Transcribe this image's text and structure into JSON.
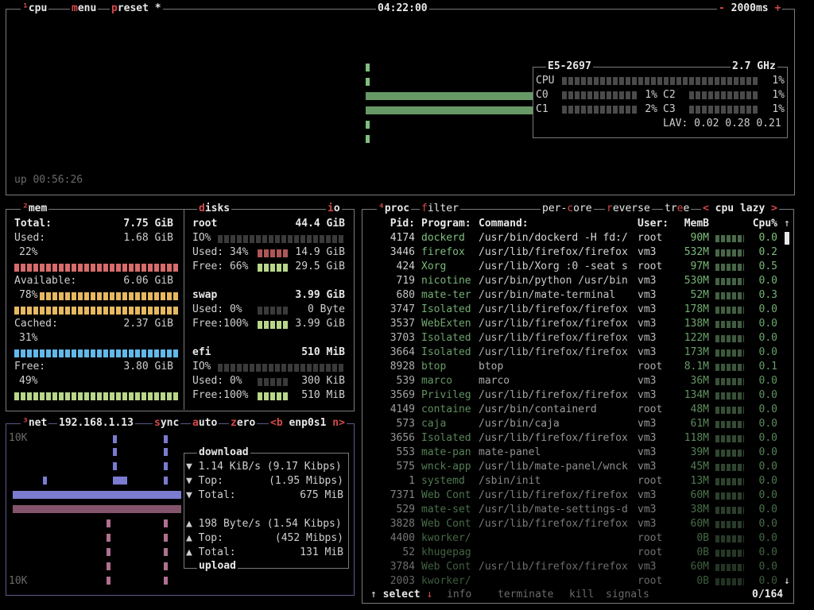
{
  "cpu": {
    "hotkey": "¹",
    "title": "cpu",
    "menu": "menu",
    "preset": "preset *",
    "clock": "04:22:00",
    "refresh": "2000ms",
    "refresh_minus": "-",
    "refresh_plus": "+",
    "uptime": "up 00:56:26",
    "model": "E5-2697",
    "freq": "2.7 GHz",
    "rows": [
      {
        "label": "CPU",
        "pct": "1%"
      },
      {
        "label": "C0",
        "pct": "1%"
      },
      {
        "label": "C1",
        "pct": "2%"
      },
      {
        "label": "C2",
        "pct": "1%"
      },
      {
        "label": "C3",
        "pct": "1%"
      }
    ],
    "lav_label": "LAV:",
    "lav": "0.02 0.28 0.21"
  },
  "mem": {
    "hotkey": "²",
    "title": "mem",
    "total_label": "Total:",
    "total": "7.75 GiB",
    "used_label": "Used:",
    "used": "1.68 GiB",
    "used_pct": "22%",
    "avail_label": "Available:",
    "avail": "6.06 GiB",
    "avail_pct": "78%",
    "cached_label": "Cached:",
    "cached": "2.37 GiB",
    "cached_pct": "31%",
    "free_label": "Free:",
    "free": "3.80 GiB",
    "free_pct": "49%"
  },
  "disks": {
    "title": "disks",
    "io": "io",
    "root": {
      "name": "root",
      "size": "44.4 GiB",
      "io": "IO%",
      "used_label": "Used: 34%",
      "used": "14.9 GiB",
      "free_label": "Free: 66%",
      "free": "29.5 GiB"
    },
    "swap": {
      "name": "swap",
      "size": "3.99 GiB",
      "used_label": "Used:  0%",
      "used": "0 Byte",
      "free_label": "Free:100%",
      "free": "3.99 GiB"
    },
    "efi": {
      "name": "efi",
      "size": "510 MiB",
      "io": "IO%",
      "used_label": "Used:  0%",
      "used": "300 KiB",
      "free_label": "Free:100%",
      "free": "510 MiB"
    }
  },
  "net": {
    "hotkey": "³",
    "title": "net",
    "ip": "192.168.1.13",
    "sync": "sync",
    "auto": "auto",
    "zero": "zero",
    "iface_prev": "<b",
    "iface": "enp0s1",
    "iface_next": "n>",
    "scale_top": "10K",
    "scale_bottom": "10K",
    "download_title": "download",
    "upload_title": "upload",
    "down_rate": "1.14 KiB/s",
    "down_rate_bits": "(9.17 Kibps)",
    "down_top_label": "Top:",
    "down_top": "(1.95 Mibps)",
    "down_total_label": "Total:",
    "down_total": "675 MiB",
    "up_rate": "198 Byte/s",
    "up_rate_bits": "(1.54 Kibps)",
    "up_top_label": "Top:",
    "up_top": "(452 Mibps)",
    "up_total_label": "Total:",
    "up_total": "131 MiB",
    "down_arrow": "▼",
    "up_arrow": "▲"
  },
  "proc": {
    "hotkey": "⁴",
    "title": "proc",
    "filter": "filter",
    "percore": "per-core",
    "reverse": "reverse",
    "tree": "tree",
    "sort_prev": "<",
    "sort": "cpu lazy",
    "sort_next": ">",
    "headers": {
      "pid": "Pid:",
      "program": "Program:",
      "command": "Command:",
      "user": "User:",
      "mem": "MemB",
      "cpu": "Cpu%"
    },
    "rows": [
      {
        "pid": "4174",
        "program": "dockerd",
        "command": "/usr/bin/dockerd -H fd:/",
        "user": "root",
        "mem": "90M",
        "cpu": "0.0"
      },
      {
        "pid": "3446",
        "program": "firefox",
        "command": "/usr/lib/firefox/firefox",
        "user": "vm3",
        "mem": "532M",
        "cpu": "0.2"
      },
      {
        "pid": "424",
        "program": "Xorg",
        "command": "/usr/lib/Xorg :0 -seat s",
        "user": "root",
        "mem": "97M",
        "cpu": "0.5"
      },
      {
        "pid": "719",
        "program": "nicotine",
        "command": "/usr/bin/python /usr/bin",
        "user": "vm3",
        "mem": "530M",
        "cpu": "0.0"
      },
      {
        "pid": "680",
        "program": "mate-ter",
        "command": "/usr/bin/mate-terminal",
        "user": "vm3",
        "mem": "52M",
        "cpu": "0.3"
      },
      {
        "pid": "3747",
        "program": "Isolated",
        "command": "/usr/lib/firefox/firefox",
        "user": "vm3",
        "mem": "178M",
        "cpu": "0.0"
      },
      {
        "pid": "3537",
        "program": "WebExten",
        "command": "/usr/lib/firefox/firefox",
        "user": "vm3",
        "mem": "138M",
        "cpu": "0.0"
      },
      {
        "pid": "3703",
        "program": "Isolated",
        "command": "/usr/lib/firefox/firefox",
        "user": "vm3",
        "mem": "122M",
        "cpu": "0.0"
      },
      {
        "pid": "3664",
        "program": "Isolated",
        "command": "/usr/lib/firefox/firefox",
        "user": "vm3",
        "mem": "173M",
        "cpu": "0.0"
      },
      {
        "pid": "8928",
        "program": "btop",
        "command": "btop",
        "user": "root",
        "mem": "8.1M",
        "cpu": "0.1"
      },
      {
        "pid": "539",
        "program": "marco",
        "command": "marco",
        "user": "vm3",
        "mem": "36M",
        "cpu": "0.0"
      },
      {
        "pid": "3569",
        "program": "Privileg",
        "command": "/usr/lib/firefox/firefox",
        "user": "vm3",
        "mem": "134M",
        "cpu": "0.0"
      },
      {
        "pid": "4149",
        "program": "containe",
        "command": "/usr/bin/containerd",
        "user": "root",
        "mem": "48M",
        "cpu": "0.0"
      },
      {
        "pid": "573",
        "program": "caja",
        "command": "/usr/bin/caja",
        "user": "vm3",
        "mem": "61M",
        "cpu": "0.0"
      },
      {
        "pid": "3656",
        "program": "Isolated",
        "command": "/usr/lib/firefox/firefox",
        "user": "vm3",
        "mem": "118M",
        "cpu": "0.0"
      },
      {
        "pid": "553",
        "program": "mate-pan",
        "command": "mate-panel",
        "user": "vm3",
        "mem": "39M",
        "cpu": "0.0"
      },
      {
        "pid": "575",
        "program": "wnck-app",
        "command": "/usr/lib/mate-panel/wnck",
        "user": "vm3",
        "mem": "45M",
        "cpu": "0.0"
      },
      {
        "pid": "1",
        "program": "systemd",
        "command": "/sbin/init",
        "user": "root",
        "mem": "13M",
        "cpu": "0.0"
      },
      {
        "pid": "7371",
        "program": "Web Cont",
        "command": "/usr/lib/firefox/firefox",
        "user": "vm3",
        "mem": "60M",
        "cpu": "0.0"
      },
      {
        "pid": "529",
        "program": "mate-set",
        "command": "/usr/lib/mate-settings-d",
        "user": "vm3",
        "mem": "38M",
        "cpu": "0.0"
      },
      {
        "pid": "3828",
        "program": "Web Cont",
        "command": "/usr/lib/firefox/firefox",
        "user": "vm3",
        "mem": "60M",
        "cpu": "0.0"
      },
      {
        "pid": "4400",
        "program": "kworker/",
        "command": "",
        "user": "root",
        "mem": "0B",
        "cpu": "0.0"
      },
      {
        "pid": "52",
        "program": "khugepag",
        "command": "",
        "user": "root",
        "mem": "0B",
        "cpu": "0.0"
      },
      {
        "pid": "3784",
        "program": "Web Cont",
        "command": "/usr/lib/firefox/firefox",
        "user": "vm3",
        "mem": "60M",
        "cpu": "0.0"
      },
      {
        "pid": "2003",
        "program": "kworker/",
        "command": "",
        "user": "root",
        "mem": "0B",
        "cpu": "0.0"
      }
    ],
    "footer": {
      "up": "↑",
      "select": "select",
      "down": "↓",
      "info": "info",
      "terminate": "terminate",
      "kill": "kill",
      "signals": "signals",
      "count": "0/164"
    }
  }
}
